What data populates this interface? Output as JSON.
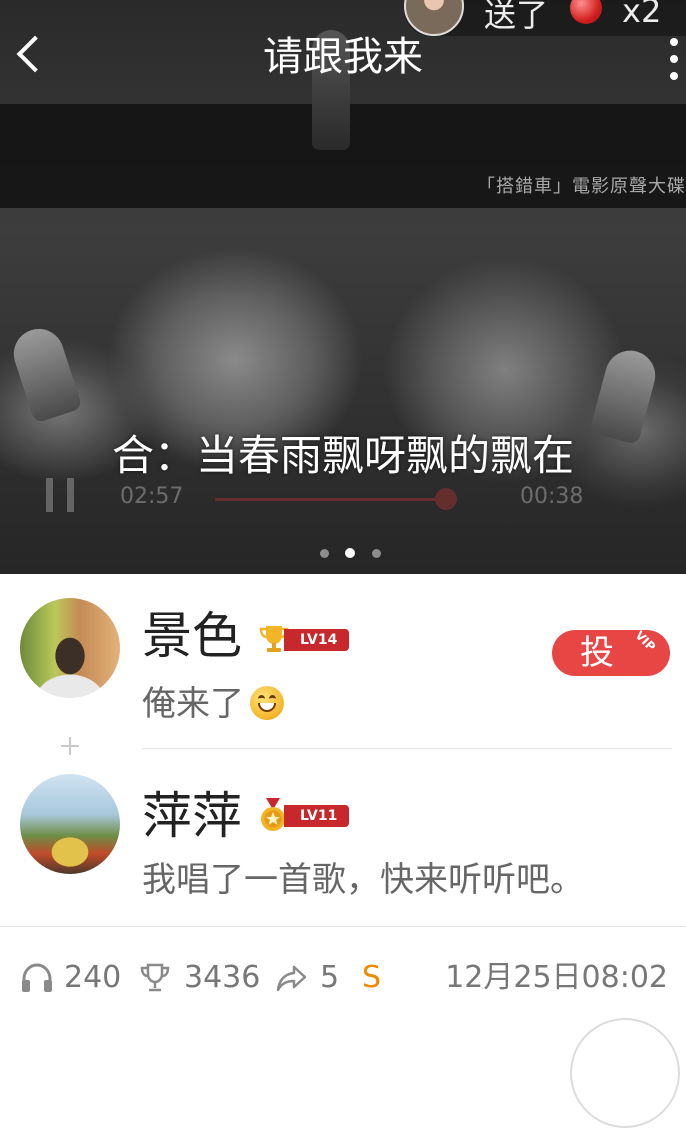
{
  "header": {
    "title": "请跟我来",
    "gift": {
      "text": "送了",
      "count": "x2"
    }
  },
  "player": {
    "poster_caption": "「搭錯車」電影原聲大碟",
    "lyric": "合：当春雨飘呀飘的飘在",
    "time_elapsed": "02:57",
    "time_total": "00:38",
    "pager": {
      "total": 3,
      "active_index": 1
    }
  },
  "comments": [
    {
      "name": "景色",
      "level": "LV14",
      "badge_icon": "trophy-icon",
      "text": "俺来了",
      "emoji": "grinning-face-icon",
      "vote_label": "投",
      "vote_tag": "VIP"
    },
    {
      "name": "萍萍",
      "level": "LV11",
      "badge_icon": "star-medal-icon",
      "text": "我唱了一首歌，快来听听吧。"
    }
  ],
  "stats": {
    "listens": "240",
    "trophies": "3436",
    "shares": "5",
    "s_label": "S",
    "timestamp": "12月25日08:02"
  },
  "colors": {
    "accent_red": "#e84545",
    "level_badge": "#c8272b",
    "s_orange": "#f08a00",
    "text_gray": "#777777"
  }
}
